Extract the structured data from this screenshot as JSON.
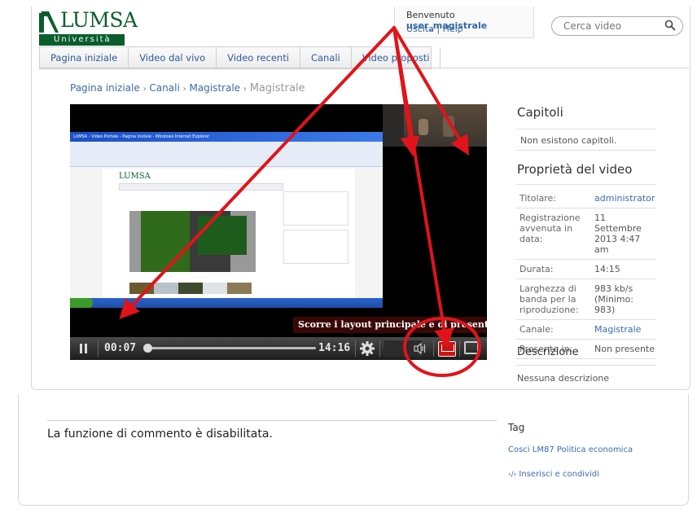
{
  "header": {
    "logo_word": "LUMSA",
    "logo_sub": "Università",
    "welcome_prefix": "Benvenuto",
    "username": "user_magistrale",
    "logout": "Uscita",
    "link_sep": "|",
    "help": "Help",
    "search_placeholder": "Cerca video"
  },
  "nav": {
    "tabs": [
      {
        "label": "Pagina iniziale"
      },
      {
        "label": "Video dal vivo"
      },
      {
        "label": "Video recenti"
      },
      {
        "label": "Canali"
      },
      {
        "label": "Video proposti"
      }
    ]
  },
  "breadcrumb": {
    "items": [
      "Pagina iniziale",
      "Canali",
      "Magistrale"
    ],
    "sep": "›",
    "current": "Magistrale"
  },
  "player": {
    "overlay_text": "Scorre i layout principale e di presentazione",
    "time_current": "00:07",
    "time_total": "14:16",
    "progress": 0.008,
    "inner_logo": "LUMSA",
    "inner_title": "LUMSA - Video Portale - Pagina iniziale - Windows Internet Explorer"
  },
  "chapters": {
    "title": "Capitoli",
    "empty": "Non esistono capitoli."
  },
  "properties": {
    "title": "Proprietà del video",
    "rows": [
      {
        "key": "Titolare:",
        "value": "administrator",
        "link": true
      },
      {
        "key": "Registrazione avvenuta in data:",
        "value": "11 Settembre 2013 4:47 am",
        "link": false
      },
      {
        "key": "Durata:",
        "value": "14:15",
        "link": false
      },
      {
        "key": "Larghezza di banda per la riproduzione:",
        "value": "983 kb/s (Minimo: 983)",
        "link": false
      },
      {
        "key": "Canale:",
        "value": "Magistrale",
        "link": true
      },
      {
        "key": "Presente in:",
        "value": "Non presente",
        "link": false
      }
    ]
  },
  "description": {
    "title": "Descrizione",
    "text": "Nessuna descrizione"
  },
  "comments": {
    "disabled_text": "La funzione di commento è disabilitata."
  },
  "tags": {
    "title": "Tag",
    "value": "Cosci LM87 Politica economica"
  },
  "share": {
    "label": "Inserisci e condividi"
  },
  "colors": {
    "brand_green": "#0b5e2c",
    "link_blue": "#3366aa",
    "annotation_red": "#e0141a"
  }
}
